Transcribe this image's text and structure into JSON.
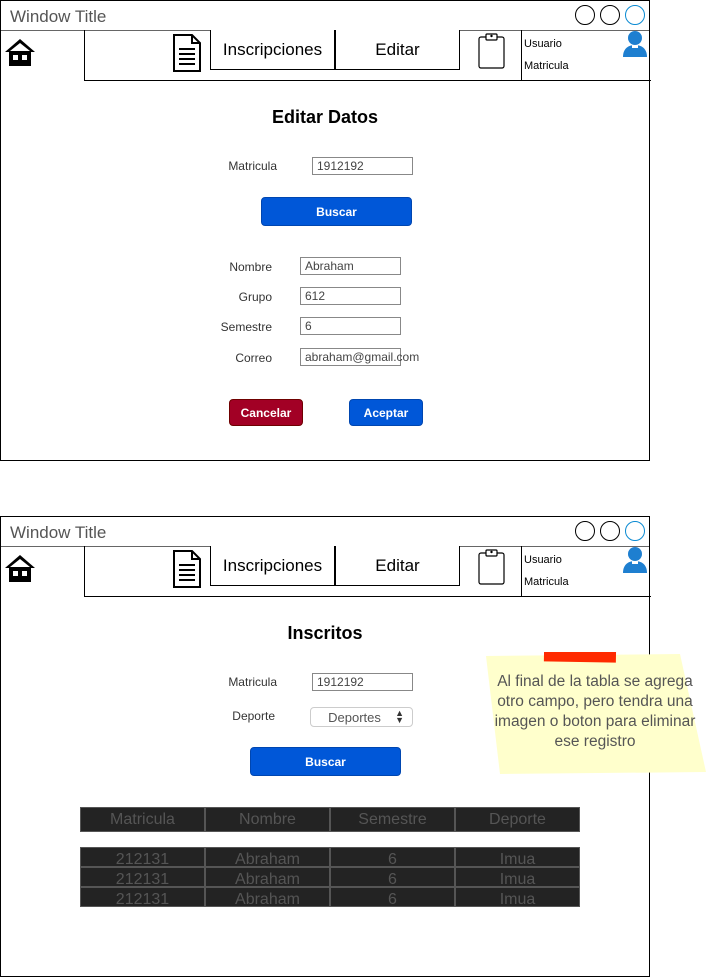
{
  "windows": [
    {
      "title": "Window Title",
      "nav": {
        "tab1": "Inscripciones",
        "tab2": "Editar",
        "user": "Usuario",
        "matricula": "Matricula"
      },
      "heading": "Editar Datos",
      "search": {
        "label": "Matricula",
        "value": "1912192",
        "button": "Buscar"
      },
      "fields": [
        {
          "label": "Nombre",
          "value": "Abraham"
        },
        {
          "label": "Grupo",
          "value": "612"
        },
        {
          "label": "Semestre",
          "value": "6"
        },
        {
          "label": "Correo",
          "value": "abraham@gmail.com"
        }
      ],
      "buttons": {
        "cancel": "Cancelar",
        "accept": "Aceptar"
      }
    },
    {
      "title": "Window Title",
      "nav": {
        "tab1": "Inscripciones",
        "tab2": "Editar",
        "user": "Usuario",
        "matricula": "Matricula"
      },
      "heading": "Inscritos",
      "search": {
        "label": "Matricula",
        "value": "1912192",
        "button": "Buscar"
      },
      "sport": {
        "label": "Deporte",
        "value": "Deportes"
      },
      "table": {
        "headers": [
          "Matricula",
          "Nombre",
          "Semestre",
          "Deporte"
        ],
        "rows": [
          [
            "212131",
            "Abraham",
            "6",
            "Imua"
          ],
          [
            "212131",
            "Abraham",
            "6",
            "Imua"
          ],
          [
            "212131",
            "Abraham",
            "6",
            "Imua"
          ]
        ]
      }
    }
  ],
  "note": {
    "text": "Al final de la tabla se agrega otro campo, pero tendra una imagen o boton para eliminar ese registro"
  },
  "colors": {
    "primary": "#0057d8",
    "danger": "#a20025",
    "note": "#ffffcc",
    "tape": "#ff2a00"
  }
}
